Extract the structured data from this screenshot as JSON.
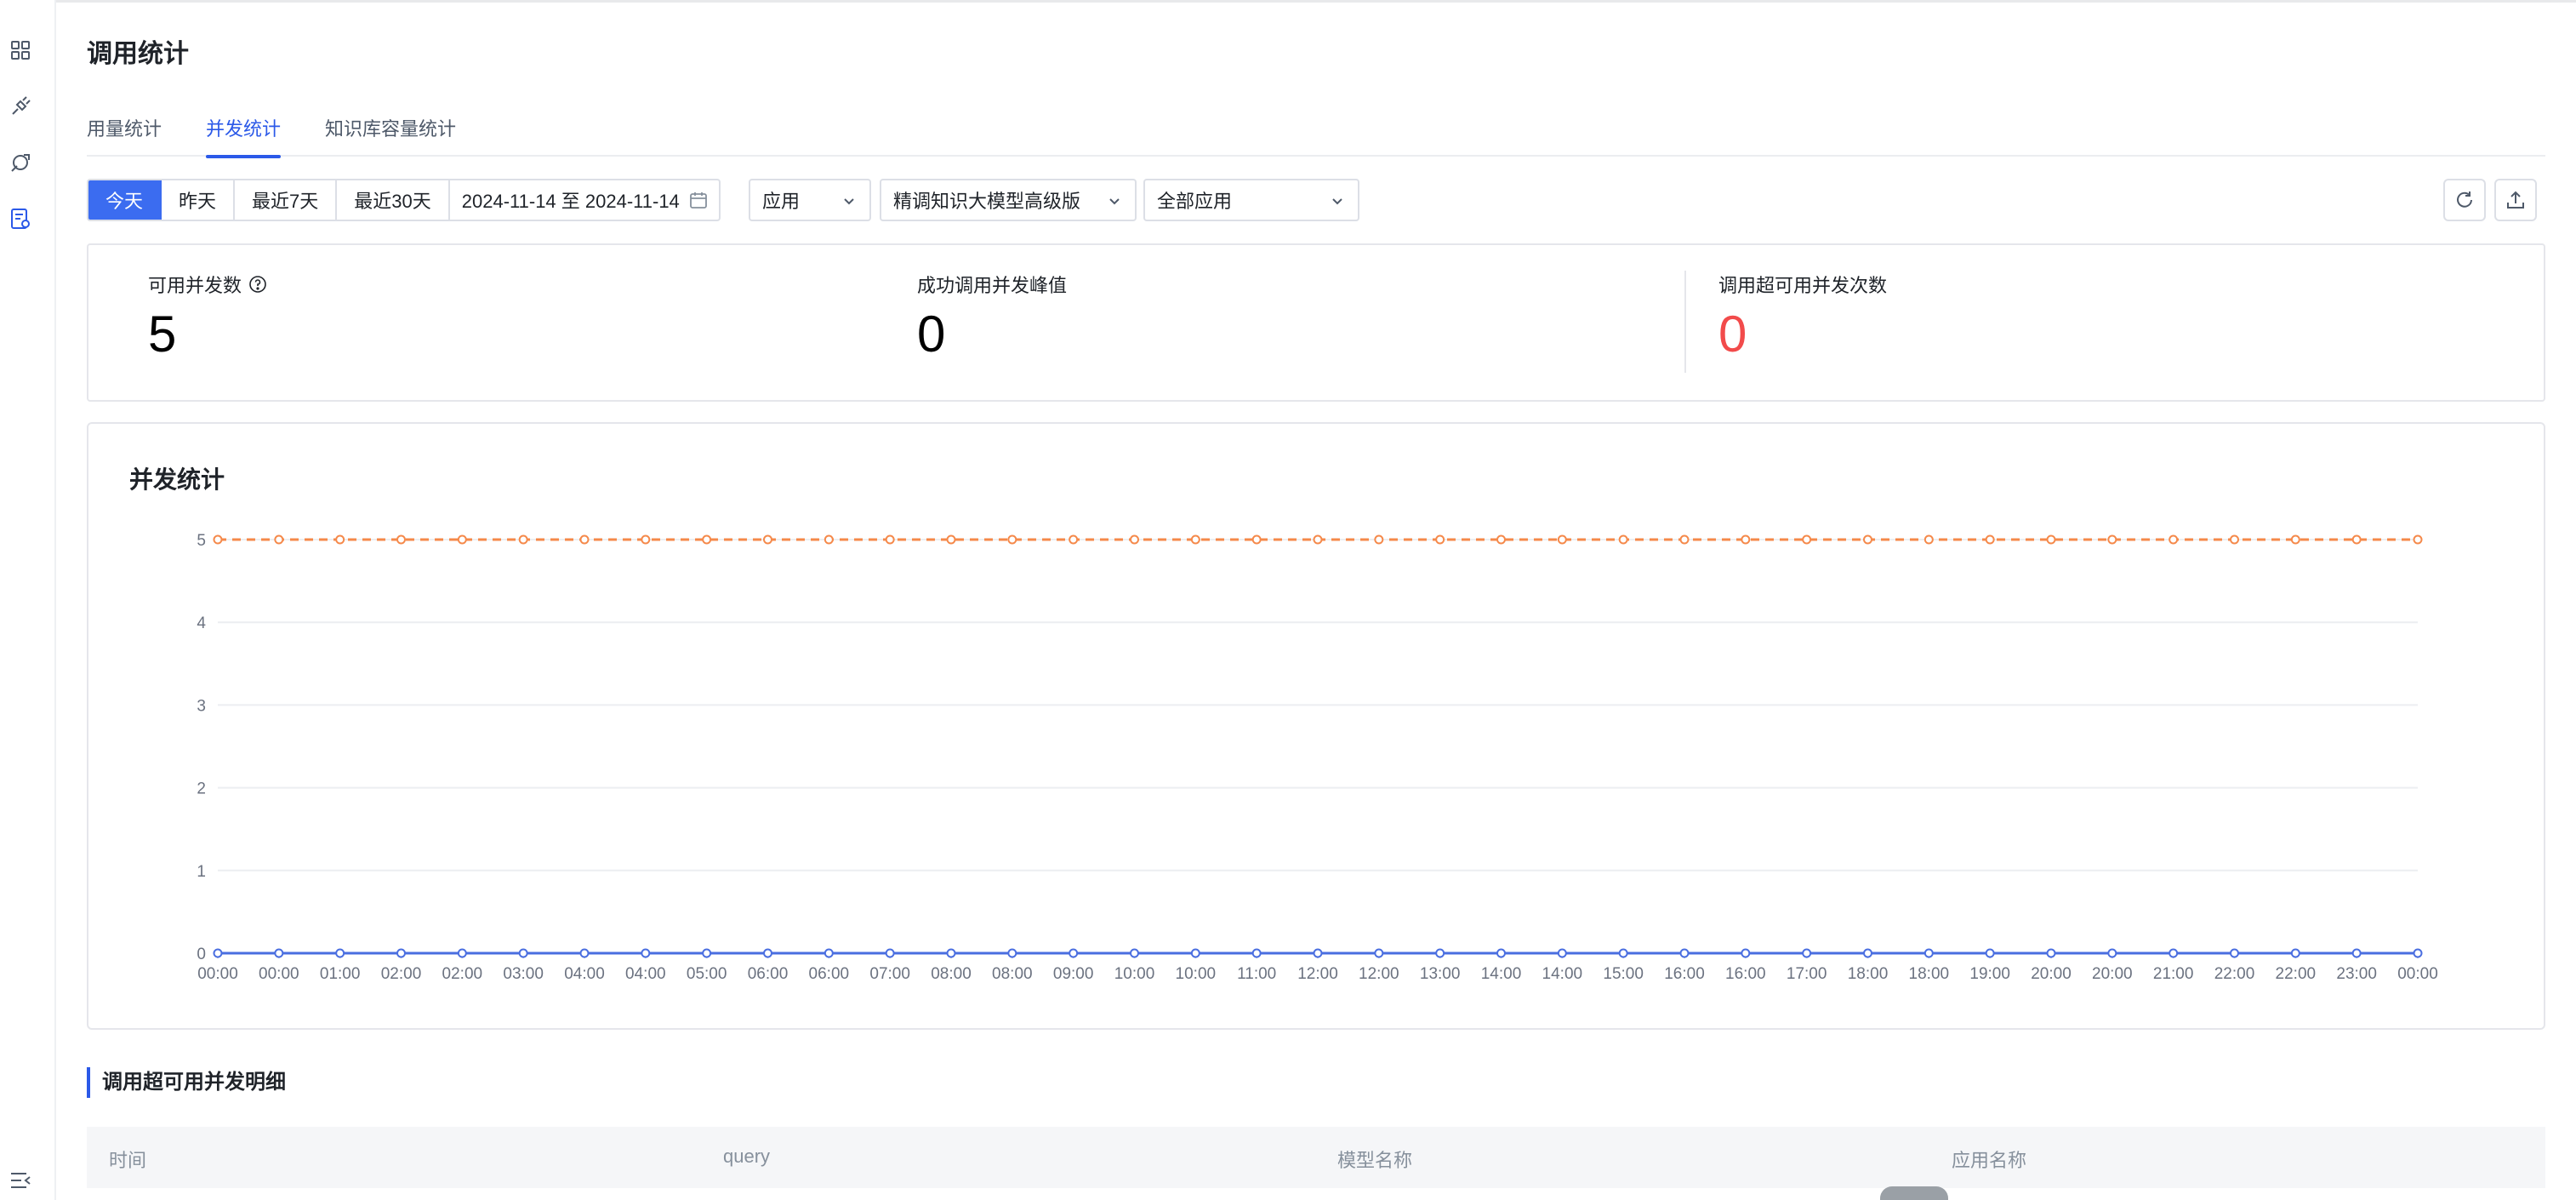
{
  "page": {
    "title": "调用统计"
  },
  "tabs": [
    {
      "label": "用量统计",
      "active": false
    },
    {
      "label": "并发统计",
      "active": true
    },
    {
      "label": "知识库容量统计",
      "active": false
    }
  ],
  "filters": {
    "range_buttons": [
      {
        "label": "今天",
        "active": true
      },
      {
        "label": "昨天",
        "active": false
      },
      {
        "label": "最近7天",
        "active": false
      },
      {
        "label": "最近30天",
        "active": false
      }
    ],
    "date_range": "2024-11-14 至 2024-11-14",
    "dimension_select": "应用",
    "model_select": "精调知识大模型高级版",
    "app_select": "全部应用"
  },
  "stats": {
    "available": {
      "label": "可用并发数",
      "value": "5"
    },
    "peak": {
      "label": "成功调用并发峰值",
      "value": "0"
    },
    "exceeded": {
      "label": "调用超可用并发次数",
      "value": "0"
    }
  },
  "colors": {
    "accent": "#2b59e8",
    "available_line": "#f5894a",
    "success_line": "#4a6ee0",
    "danger": "#f24b4b"
  },
  "chart_data": {
    "type": "line",
    "title": "并发统计",
    "x": [
      "00:00",
      "00:00",
      "01:00",
      "02:00",
      "02:00",
      "03:00",
      "04:00",
      "04:00",
      "05:00",
      "06:00",
      "06:00",
      "07:00",
      "08:00",
      "08:00",
      "09:00",
      "10:00",
      "10:00",
      "11:00",
      "12:00",
      "12:00",
      "13:00",
      "14:00",
      "14:00",
      "15:00",
      "16:00",
      "16:00",
      "17:00",
      "18:00",
      "18:00",
      "19:00",
      "20:00",
      "20:00",
      "21:00",
      "22:00",
      "22:00",
      "23:00",
      "00:00"
    ],
    "series": [
      {
        "values": [
          5,
          5,
          5,
          5,
          5,
          5,
          5,
          5,
          5,
          5,
          5,
          5,
          5,
          5,
          5,
          5,
          5,
          5,
          5,
          5,
          5,
          5,
          5,
          5,
          5,
          5,
          5,
          5,
          5,
          5,
          5,
          5,
          5,
          5,
          5,
          5,
          5
        ],
        "style": "dashed"
      },
      {
        "values": [
          0,
          0,
          0,
          0,
          0,
          0,
          0,
          0,
          0,
          0,
          0,
          0,
          0,
          0,
          0,
          0,
          0,
          0,
          0,
          0,
          0,
          0,
          0,
          0,
          0,
          0,
          0,
          0,
          0,
          0,
          0,
          0,
          0,
          0,
          0,
          0,
          0
        ],
        "style": "solid"
      }
    ],
    "yticks": [
      0,
      1,
      2,
      3,
      4,
      5
    ],
    "ylim": [
      0,
      5
    ],
    "grid": true,
    "legend": "none"
  },
  "detail": {
    "title": "调用超可用并发明细",
    "columns": [
      "时间",
      "query",
      "模型名称",
      "应用名称"
    ]
  }
}
